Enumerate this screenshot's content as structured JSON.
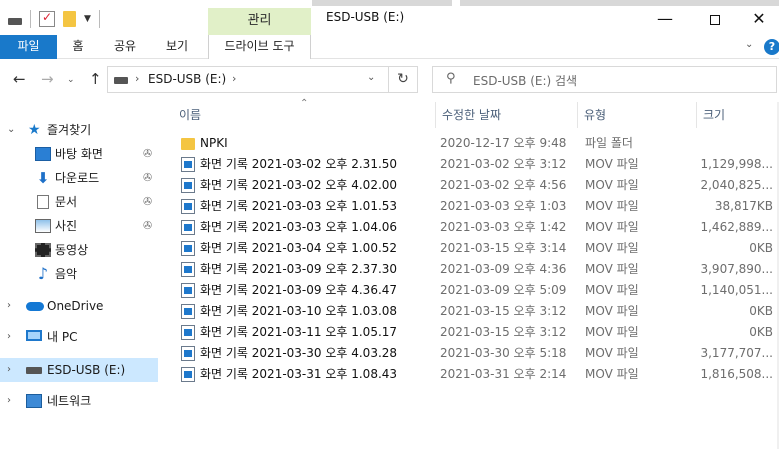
{
  "window": {
    "title": "ESD-USB (E:)",
    "context_tab": "관리"
  },
  "ribbon": {
    "tabs": [
      "파일",
      "홈",
      "공유",
      "보기",
      "드라이브 도구"
    ]
  },
  "address": {
    "path": "ESD-USB (E:)",
    "search_placeholder": "ESD-USB (E:) 검색"
  },
  "sidebar": {
    "quick_access": "즐겨찾기",
    "pinned": [
      {
        "label": "바탕 화면",
        "icon": "desktop-icon"
      },
      {
        "label": "다운로드",
        "icon": "download-icon"
      },
      {
        "label": "문서",
        "icon": "document-icon"
      },
      {
        "label": "사진",
        "icon": "picture-icon"
      }
    ],
    "unpinned": [
      {
        "label": "동영상",
        "icon": "video-icon"
      },
      {
        "label": "음악",
        "icon": "music-icon"
      }
    ],
    "onedrive": "OneDrive",
    "pc": "내 PC",
    "usb": "ESD-USB (E:)",
    "network": "네트워크"
  },
  "columns": {
    "name": "이름",
    "date": "수정한 날짜",
    "type": "유형",
    "size": "크기"
  },
  "files": [
    {
      "name": "NPKI",
      "date": "2020-12-17 오후 9:48",
      "type": "파일 폴더",
      "size": "",
      "kind": "folder"
    },
    {
      "name": "화면 기록 2021-03-02 오후 2.31.50",
      "date": "2021-03-02 오후 3:12",
      "type": "MOV 파일",
      "size": "1,129,998...",
      "kind": "mov"
    },
    {
      "name": "화면 기록 2021-03-02 오후 4.02.00",
      "date": "2021-03-02 오후 4:56",
      "type": "MOV 파일",
      "size": "2,040,825...",
      "kind": "mov"
    },
    {
      "name": "화면 기록 2021-03-03 오후 1.01.53",
      "date": "2021-03-03 오후 1:03",
      "type": "MOV 파일",
      "size": "38,817KB",
      "kind": "mov"
    },
    {
      "name": "화면 기록 2021-03-03 오후 1.04.06",
      "date": "2021-03-03 오후 1:42",
      "type": "MOV 파일",
      "size": "1,462,889...",
      "kind": "mov"
    },
    {
      "name": "화면 기록 2021-03-04 오후 1.00.52",
      "date": "2021-03-15 오후 3:14",
      "type": "MOV 파일",
      "size": "0KB",
      "kind": "mov"
    },
    {
      "name": "화면 기록 2021-03-09 오후 2.37.30",
      "date": "2021-03-09 오후 4:36",
      "type": "MOV 파일",
      "size": "3,907,890...",
      "kind": "mov"
    },
    {
      "name": "화면 기록 2021-03-09 오후 4.36.47",
      "date": "2021-03-09 오후 5:09",
      "type": "MOV 파일",
      "size": "1,140,051...",
      "kind": "mov"
    },
    {
      "name": "화면 기록 2021-03-10 오후 1.03.08",
      "date": "2021-03-15 오후 3:12",
      "type": "MOV 파일",
      "size": "0KB",
      "kind": "mov"
    },
    {
      "name": "화면 기록 2021-03-11 오후 1.05.17",
      "date": "2021-03-15 오후 3:12",
      "type": "MOV 파일",
      "size": "0KB",
      "kind": "mov"
    },
    {
      "name": "화면 기록 2021-03-30 오후 4.03.28",
      "date": "2021-03-30 오후 5:18",
      "type": "MOV 파일",
      "size": "3,177,707...",
      "kind": "mov"
    },
    {
      "name": "화면 기록 2021-03-31 오후 1.08.43",
      "date": "2021-03-31 오후 2:14",
      "type": "MOV 파일",
      "size": "1,816,508...",
      "kind": "mov"
    }
  ]
}
